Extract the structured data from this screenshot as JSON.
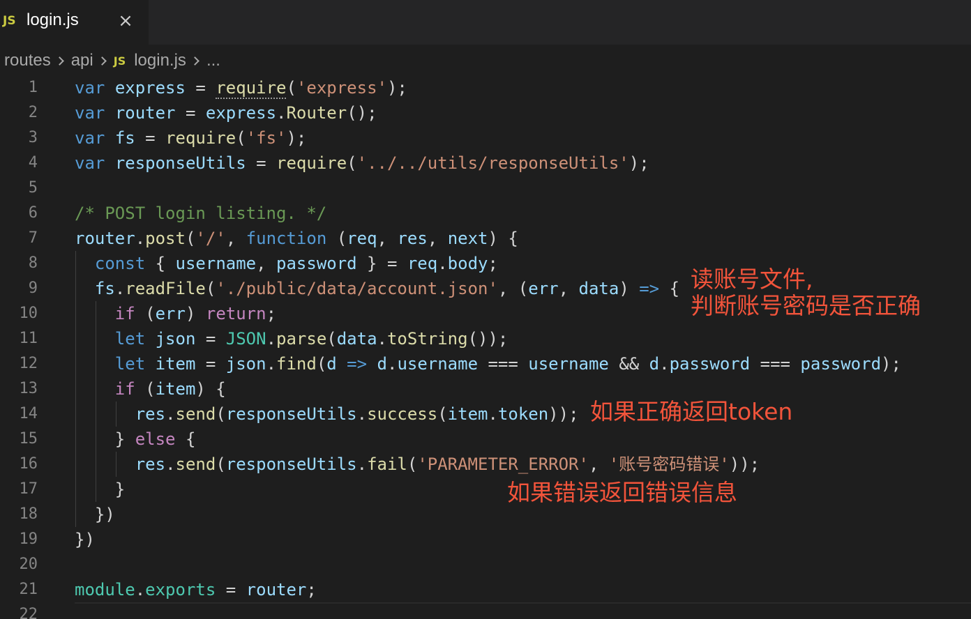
{
  "tab": {
    "badge": "JS",
    "title": "login.js",
    "close": "×"
  },
  "breadcrumb": [
    "routes",
    "api",
    "login.js",
    "..."
  ],
  "lines": [
    {
      "n": "1",
      "tokens": [
        [
          "k",
          "var"
        ],
        [
          "p",
          " "
        ],
        [
          "v",
          "express"
        ],
        [
          "p",
          " = "
        ],
        [
          "fsq",
          "require"
        ],
        [
          "p",
          "("
        ],
        [
          "s",
          "'express'"
        ],
        [
          "p",
          ");"
        ]
      ]
    },
    {
      "n": "2",
      "tokens": [
        [
          "k",
          "var"
        ],
        [
          "p",
          " "
        ],
        [
          "v",
          "router"
        ],
        [
          "p",
          " = "
        ],
        [
          "v",
          "express"
        ],
        [
          "p",
          "."
        ],
        [
          "f",
          "Router"
        ],
        [
          "p",
          "();"
        ]
      ]
    },
    {
      "n": "3",
      "tokens": [
        [
          "k",
          "var"
        ],
        [
          "p",
          " "
        ],
        [
          "v",
          "fs"
        ],
        [
          "p",
          " = "
        ],
        [
          "f",
          "require"
        ],
        [
          "p",
          "("
        ],
        [
          "s",
          "'fs'"
        ],
        [
          "p",
          ");"
        ]
      ]
    },
    {
      "n": "4",
      "tokens": [
        [
          "k",
          "var"
        ],
        [
          "p",
          " "
        ],
        [
          "v",
          "responseUtils"
        ],
        [
          "p",
          " = "
        ],
        [
          "f",
          "require"
        ],
        [
          "p",
          "("
        ],
        [
          "s",
          "'../../utils/responseUtils'"
        ],
        [
          "p",
          ");"
        ]
      ]
    },
    {
      "n": "5",
      "tokens": []
    },
    {
      "n": "6",
      "tokens": [
        [
          "c",
          "/* POST login listing. */"
        ]
      ]
    },
    {
      "n": "7",
      "tokens": [
        [
          "v",
          "router"
        ],
        [
          "p",
          "."
        ],
        [
          "f",
          "post"
        ],
        [
          "p",
          "("
        ],
        [
          "s",
          "'/'"
        ],
        [
          "p",
          ", "
        ],
        [
          "k",
          "function"
        ],
        [
          "p",
          " ("
        ],
        [
          "v",
          "req"
        ],
        [
          "p",
          ", "
        ],
        [
          "v",
          "res"
        ],
        [
          "p",
          ", "
        ],
        [
          "v",
          "next"
        ],
        [
          "p",
          ") {"
        ]
      ]
    },
    {
      "n": "8",
      "tokens": [
        [
          "p",
          "  "
        ],
        [
          "k",
          "const"
        ],
        [
          "p",
          " { "
        ],
        [
          "v",
          "username"
        ],
        [
          "p",
          ", "
        ],
        [
          "v",
          "password"
        ],
        [
          "p",
          " } = "
        ],
        [
          "v",
          "req"
        ],
        [
          "p",
          "."
        ],
        [
          "v",
          "body"
        ],
        [
          "p",
          ";"
        ]
      ]
    },
    {
      "n": "9",
      "tokens": [
        [
          "p",
          "  "
        ],
        [
          "v",
          "fs"
        ],
        [
          "p",
          "."
        ],
        [
          "f",
          "readFile"
        ],
        [
          "p",
          "("
        ],
        [
          "s",
          "'./public/data/account.json'"
        ],
        [
          "p",
          ", ("
        ],
        [
          "v",
          "err"
        ],
        [
          "p",
          ", "
        ],
        [
          "v",
          "data"
        ],
        [
          "p",
          ") "
        ],
        [
          "k",
          "=>"
        ],
        [
          "p",
          " {"
        ]
      ]
    },
    {
      "n": "10",
      "tokens": [
        [
          "p",
          "    "
        ],
        [
          "ck",
          "if"
        ],
        [
          "p",
          " ("
        ],
        [
          "v",
          "err"
        ],
        [
          "p",
          ") "
        ],
        [
          "ck",
          "return"
        ],
        [
          "p",
          ";"
        ]
      ]
    },
    {
      "n": "11",
      "tokens": [
        [
          "p",
          "    "
        ],
        [
          "k",
          "let"
        ],
        [
          "p",
          " "
        ],
        [
          "v",
          "json"
        ],
        [
          "p",
          " = "
        ],
        [
          "t",
          "JSON"
        ],
        [
          "p",
          "."
        ],
        [
          "f",
          "parse"
        ],
        [
          "p",
          "("
        ],
        [
          "v",
          "data"
        ],
        [
          "p",
          "."
        ],
        [
          "f",
          "toString"
        ],
        [
          "p",
          "());"
        ]
      ]
    },
    {
      "n": "12",
      "tokens": [
        [
          "p",
          "    "
        ],
        [
          "k",
          "let"
        ],
        [
          "p",
          " "
        ],
        [
          "v",
          "item"
        ],
        [
          "p",
          " = "
        ],
        [
          "v",
          "json"
        ],
        [
          "p",
          "."
        ],
        [
          "f",
          "find"
        ],
        [
          "p",
          "("
        ],
        [
          "v",
          "d"
        ],
        [
          "p",
          " "
        ],
        [
          "k",
          "=>"
        ],
        [
          "p",
          " "
        ],
        [
          "v",
          "d"
        ],
        [
          "p",
          "."
        ],
        [
          "v",
          "username"
        ],
        [
          "p",
          " === "
        ],
        [
          "v",
          "username"
        ],
        [
          "p",
          " && "
        ],
        [
          "v",
          "d"
        ],
        [
          "p",
          "."
        ],
        [
          "v",
          "password"
        ],
        [
          "p",
          " === "
        ],
        [
          "v",
          "password"
        ],
        [
          "p",
          ");"
        ]
      ]
    },
    {
      "n": "13",
      "tokens": [
        [
          "p",
          "    "
        ],
        [
          "ck",
          "if"
        ],
        [
          "p",
          " ("
        ],
        [
          "v",
          "item"
        ],
        [
          "p",
          ") {"
        ]
      ]
    },
    {
      "n": "14",
      "tokens": [
        [
          "p",
          "      "
        ],
        [
          "v",
          "res"
        ],
        [
          "p",
          "."
        ],
        [
          "f",
          "send"
        ],
        [
          "p",
          "("
        ],
        [
          "v",
          "responseUtils"
        ],
        [
          "p",
          "."
        ],
        [
          "f",
          "success"
        ],
        [
          "p",
          "("
        ],
        [
          "v",
          "item"
        ],
        [
          "p",
          "."
        ],
        [
          "v",
          "token"
        ],
        [
          "p",
          "));"
        ]
      ]
    },
    {
      "n": "15",
      "tokens": [
        [
          "p",
          "    } "
        ],
        [
          "ck",
          "else"
        ],
        [
          "p",
          " {"
        ]
      ]
    },
    {
      "n": "16",
      "tokens": [
        [
          "p",
          "      "
        ],
        [
          "v",
          "res"
        ],
        [
          "p",
          "."
        ],
        [
          "f",
          "send"
        ],
        [
          "p",
          "("
        ],
        [
          "v",
          "responseUtils"
        ],
        [
          "p",
          "."
        ],
        [
          "f",
          "fail"
        ],
        [
          "p",
          "("
        ],
        [
          "s",
          "'PARAMETER_ERROR'"
        ],
        [
          "p",
          ", "
        ],
        [
          "s",
          "'账号密码错误'"
        ],
        [
          "p",
          "));"
        ]
      ]
    },
    {
      "n": "17",
      "tokens": [
        [
          "p",
          "    }"
        ]
      ]
    },
    {
      "n": "18",
      "tokens": [
        [
          "p",
          "  })"
        ]
      ]
    },
    {
      "n": "19",
      "tokens": [
        [
          "p",
          "})"
        ]
      ]
    },
    {
      "n": "20",
      "tokens": []
    },
    {
      "n": "21",
      "tokens": [
        [
          "t",
          "module"
        ],
        [
          "p",
          "."
        ],
        [
          "t",
          "exports"
        ],
        [
          "p",
          " = "
        ],
        [
          "v",
          "router"
        ],
        [
          "p",
          ";"
        ]
      ]
    },
    {
      "n": "22",
      "tokens": []
    }
  ],
  "annotations": {
    "read_file": "读账号文件,\n判断账号密码是否正确",
    "success": "如果正确返回token",
    "error": "如果错误返回错误信息"
  },
  "colors": {
    "annotation": "#f2543b",
    "keyword": "#569cd6",
    "string": "#ce9178",
    "comment": "#6a9955"
  }
}
